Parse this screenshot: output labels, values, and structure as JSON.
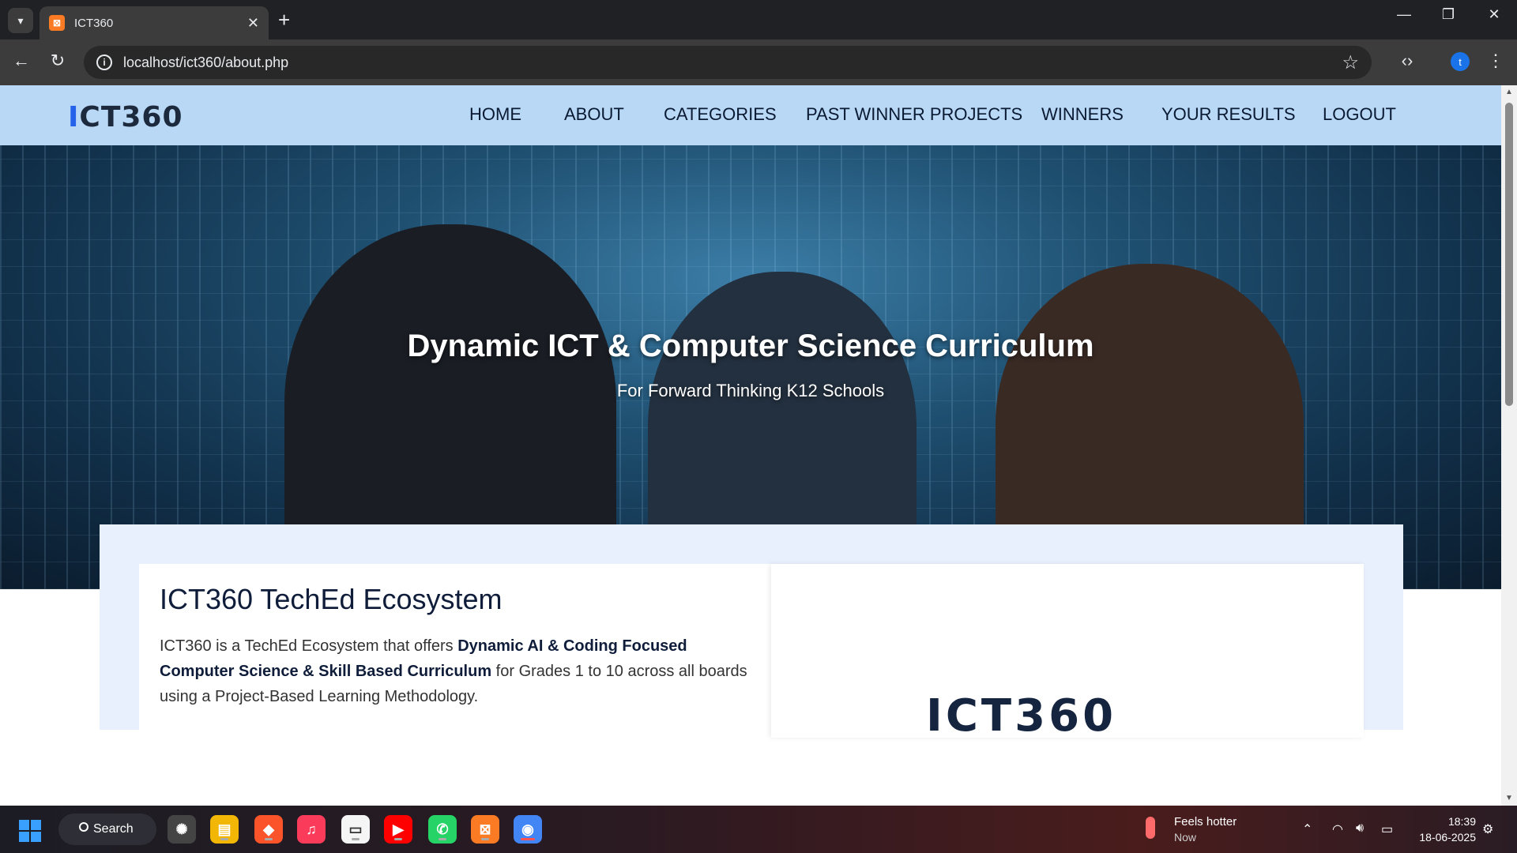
{
  "browser": {
    "tab_title": "ICT360",
    "url": "localhost/ict360/about.php",
    "profile_initial": "t"
  },
  "site": {
    "logo_text": "ICT360",
    "menu": [
      "HOME",
      "ABOUT",
      "CATEGORIES",
      "PAST WINNER PROJECTS",
      "WINNERS",
      "YOUR RESULTS",
      "LOGOUT"
    ]
  },
  "hero": {
    "title": "Dynamic ICT & Computer Science Curriculum",
    "subtitle": "For Forward Thinking K12 Schools"
  },
  "about": {
    "heading": "ICT360 TechEd Ecosystem",
    "text_1": "ICT360 is a TechEd Ecosystem that offers ",
    "text_bold": "Dynamic AI & Coding Focused Computer Science & Skill Based Curriculum",
    "text_2": " for Grades 1 to 10 across all boards using a Project-Based Learning Methodology.",
    "image_logo_text": "ICT360"
  },
  "taskbar": {
    "search_label": "Search",
    "weather_title": "Feels hotter",
    "weather_sub": "Now",
    "time": "18:39",
    "date": "18-06-2025"
  },
  "colors": {
    "nav_bg": "#b9d8f5",
    "section_bg": "#e8effd",
    "heading": "#0f1d3a"
  }
}
